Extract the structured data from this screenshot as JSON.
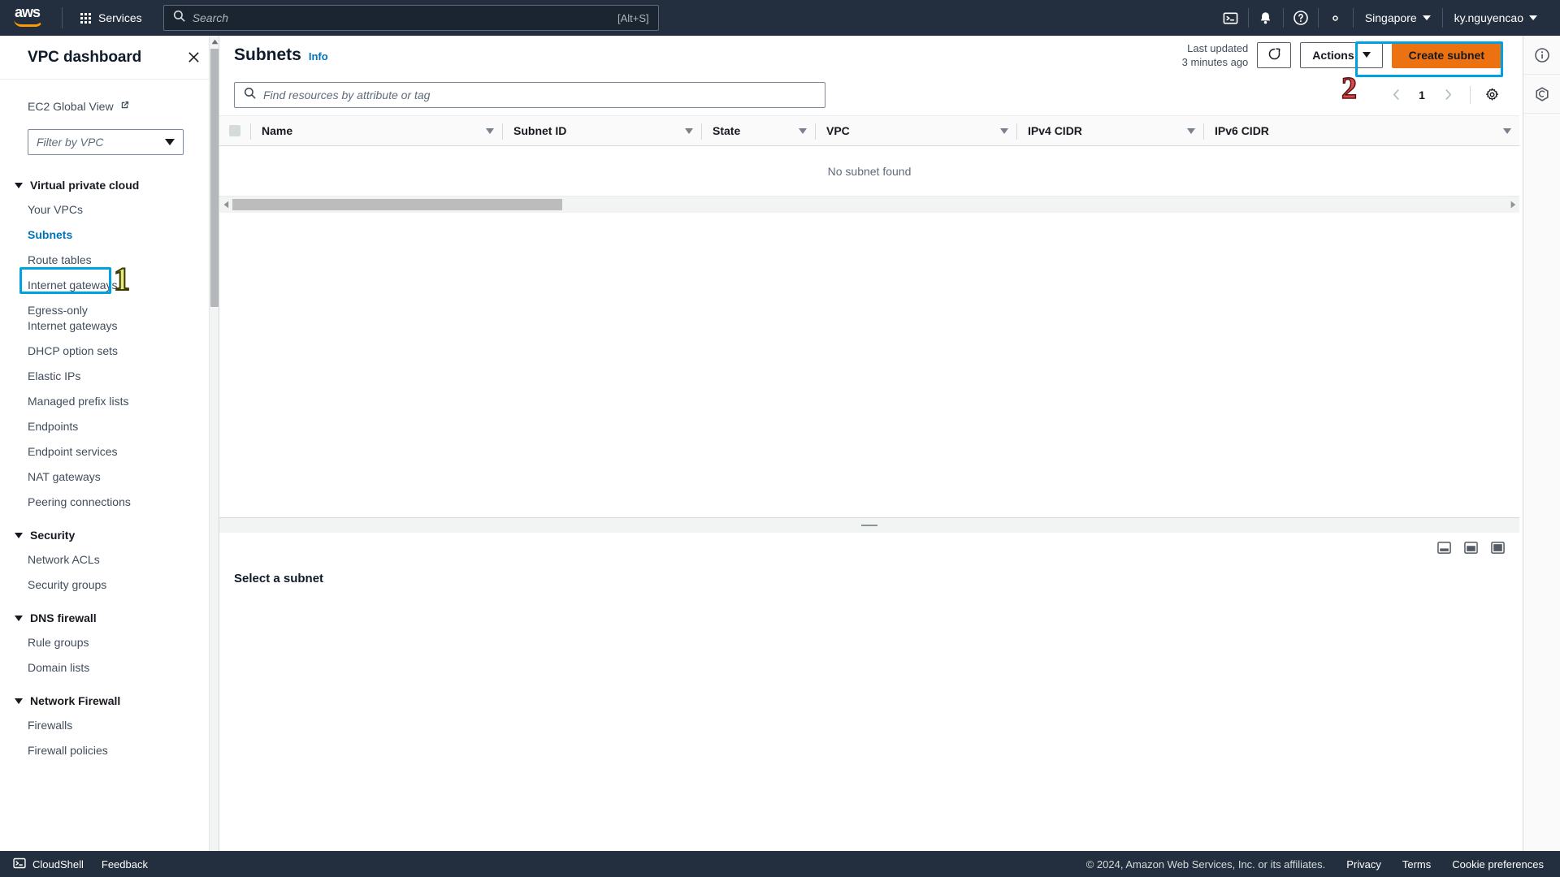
{
  "topnav": {
    "logo_text": "aws",
    "services_label": "Services",
    "search": {
      "placeholder": "Search",
      "value": "",
      "shortcut_hint": "[Alt+S]",
      "icon": "search-icon"
    },
    "icons": [
      {
        "name": "cloudshell-icon",
        "label": "CloudShell"
      },
      {
        "name": "bell-icon",
        "label": "Notifications"
      },
      {
        "name": "help-circle-icon",
        "label": "Help"
      },
      {
        "name": "gear-icon",
        "label": "Settings"
      }
    ],
    "region": "Singapore",
    "account": "ky.nguyencao"
  },
  "sidebar": {
    "title": "VPC dashboard",
    "close_icon": "close-icon",
    "ec2_global_view": "EC2 Global View",
    "ec2_global_view_icon": "external-link-icon",
    "vpc_filter_placeholder": "Filter by VPC",
    "groups": [
      {
        "label": "Virtual private cloud",
        "items": [
          "Your VPCs",
          "Subnets",
          "Route tables",
          "Internet gateways",
          "Egress-only Internet gateways",
          "DHCP option sets",
          "Elastic IPs",
          "Managed prefix lists",
          "Endpoints",
          "Endpoint services",
          "NAT gateways",
          "Peering connections"
        ]
      },
      {
        "label": "Security",
        "items": [
          "Network ACLs",
          "Security groups"
        ]
      },
      {
        "label": "DNS firewall",
        "items": [
          "Rule groups",
          "Domain lists"
        ]
      },
      {
        "label": "Network Firewall",
        "items": [
          "Firewalls",
          "Firewall policies"
        ]
      }
    ],
    "active_item": "Subnets"
  },
  "annotations": {
    "marker_1": "1",
    "marker_1_target": "Subnets",
    "marker_1_color": "#e8ea7a",
    "marker_2": "2",
    "marker_2_target": "Create subnet",
    "marker_2_color": "#d94a4a",
    "highlight_color": "#00a1e0"
  },
  "content": {
    "title": "Subnets",
    "info_link": "Info",
    "last_updated_line1": "Last updated",
    "last_updated_line2": "3 minutes ago",
    "refresh_icon": "refresh-icon",
    "actions_label": "Actions",
    "create_label": "Create subnet",
    "create_button_color": "#ec7211",
    "search": {
      "placeholder": "Find resources by attribute or tag",
      "value": "",
      "icon": "search-icon"
    },
    "pagination": {
      "prev_icon": "chevron-left-icon",
      "page": "1",
      "next_icon": "chevron-right-icon",
      "preferences_icon": "gear-icon"
    },
    "table": {
      "columns": [
        "Name",
        "Subnet ID",
        "State",
        "VPC",
        "IPv4 CIDR",
        "IPv6 CIDR"
      ],
      "rows": [],
      "empty_message": "No subnet found"
    }
  },
  "detail": {
    "title": "Select a subnet",
    "layout_icons": [
      "split-bottom-icon",
      "split-side-icon",
      "full-panel-icon"
    ]
  },
  "right_rail": [
    {
      "name": "info-circle-icon"
    },
    {
      "name": "shortcuts-icon"
    }
  ],
  "footer": {
    "cloudshell": "CloudShell",
    "cloudshell_icon": "terminal-icon",
    "feedback": "Feedback",
    "copyright": "© 2024, Amazon Web Services, Inc. or its affiliates.",
    "links": [
      "Privacy",
      "Terms",
      "Cookie preferences"
    ]
  }
}
